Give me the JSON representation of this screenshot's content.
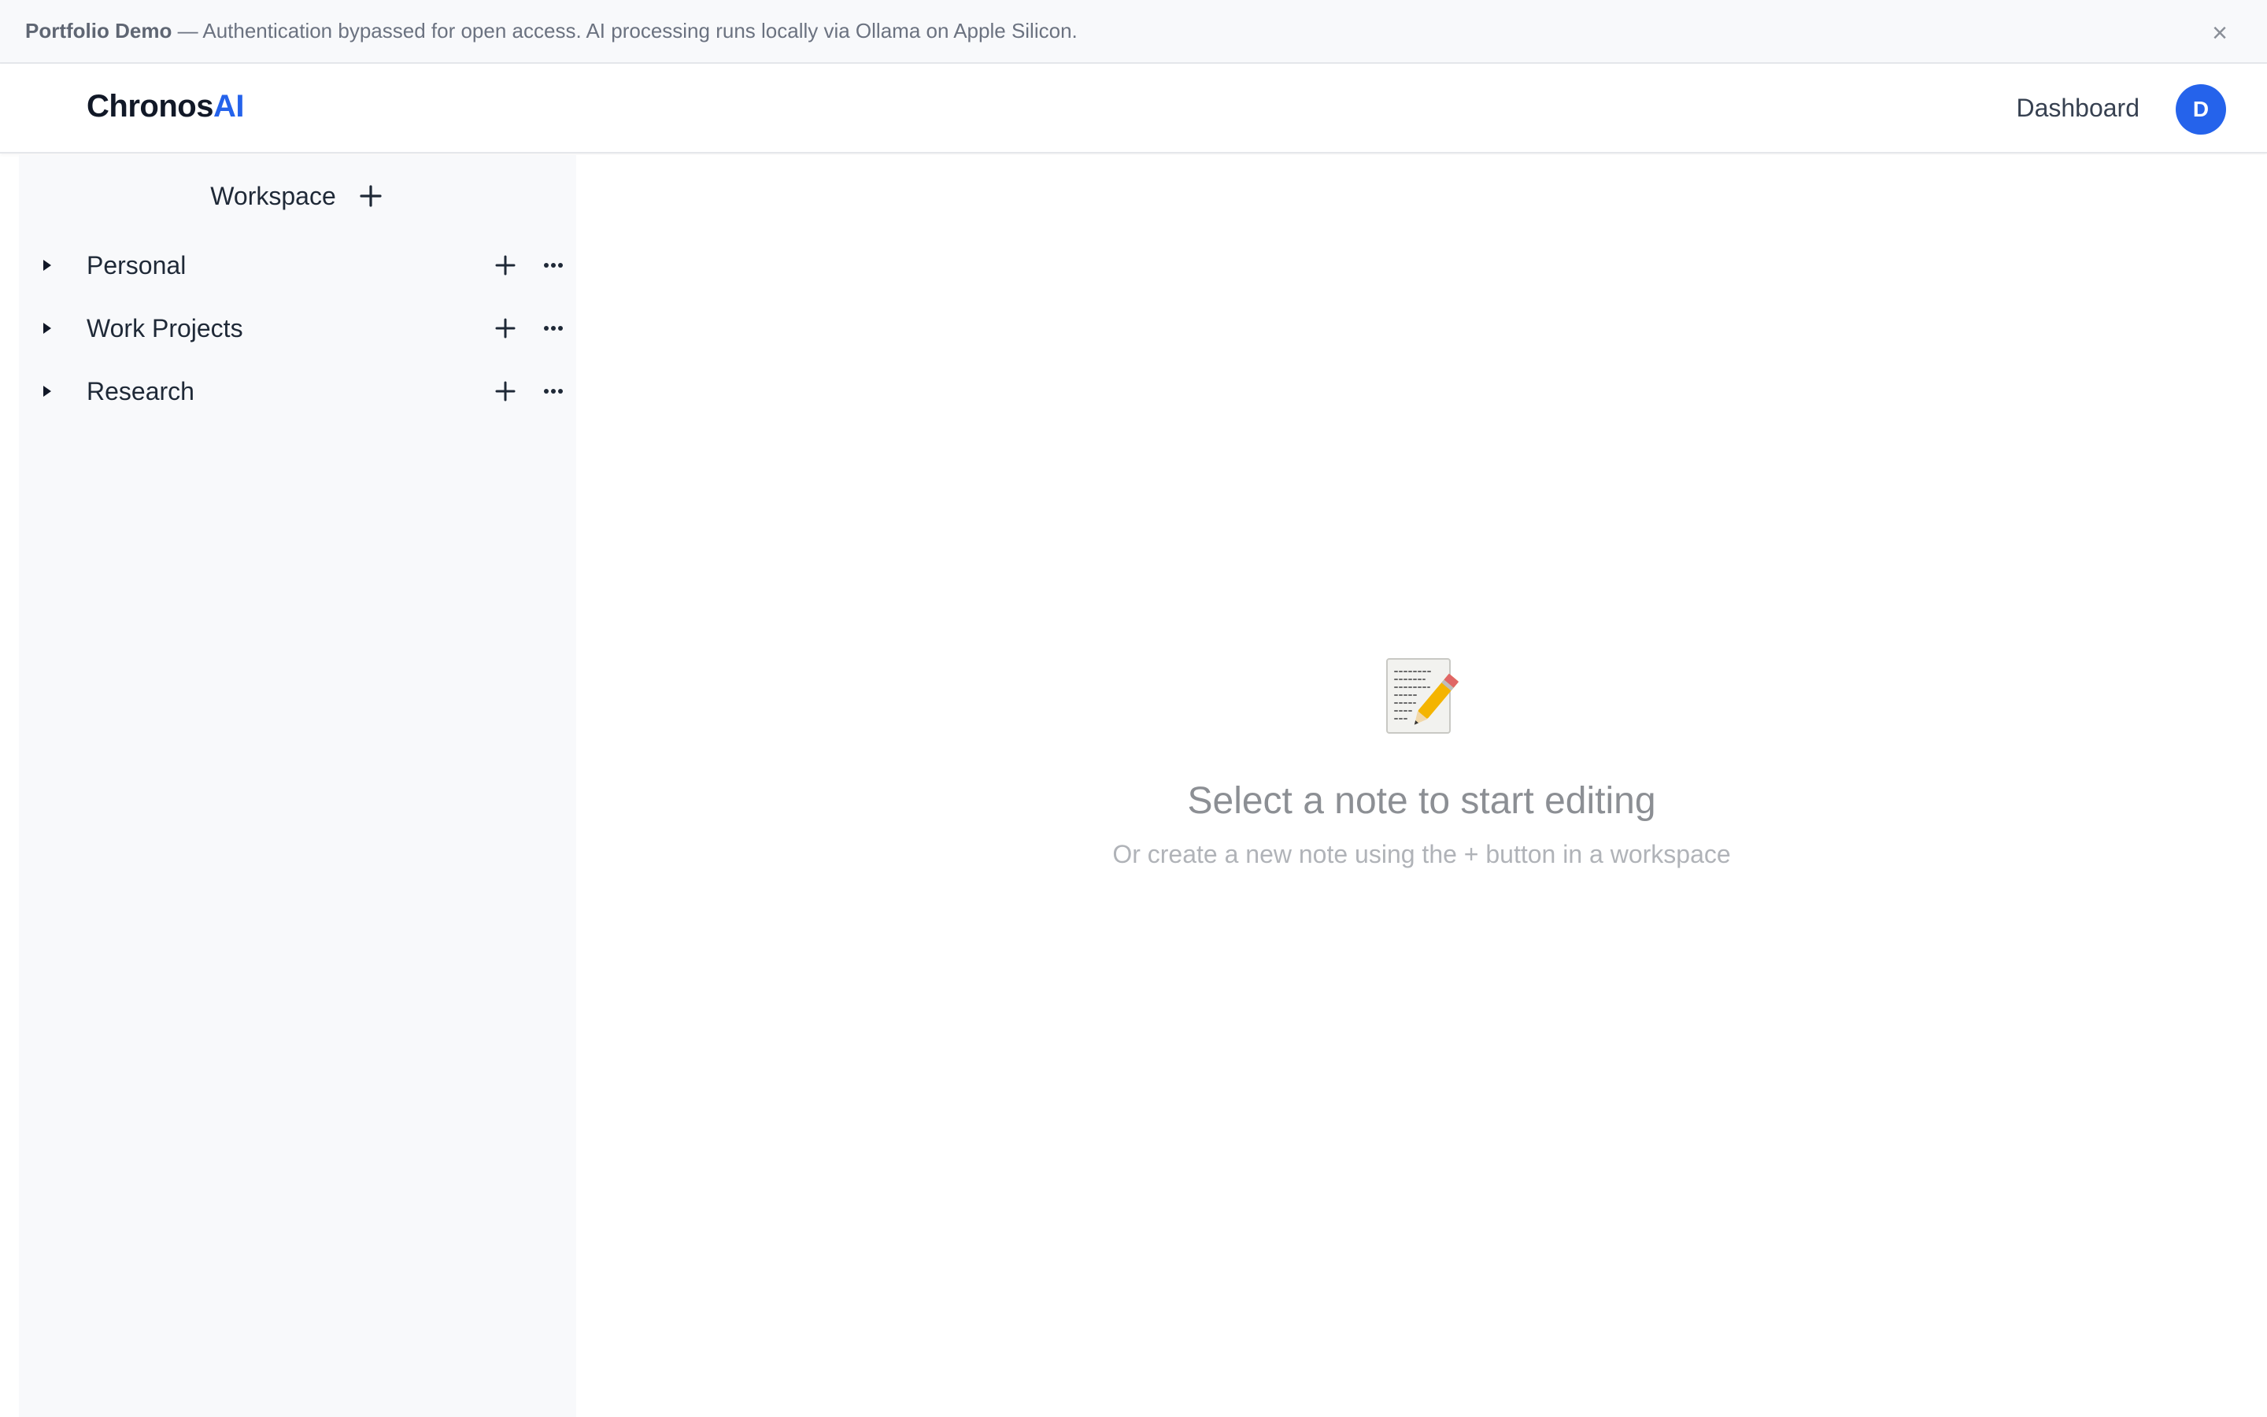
{
  "banner": {
    "strong": "Portfolio Demo",
    "message": " — Authentication bypassed for open access. AI processing runs locally via Ollama on Apple Silicon.",
    "close_glyph": "×"
  },
  "header": {
    "brand_main": "Chronos",
    "brand_accent": "AI",
    "nav_dashboard": "Dashboard",
    "avatar_initial": "D"
  },
  "sidebar": {
    "title": "Workspace",
    "workspaces": [
      {
        "label": "Personal"
      },
      {
        "label": "Work Projects"
      },
      {
        "label": "Research"
      }
    ]
  },
  "empty_state": {
    "icon": "memo-pencil-icon",
    "title": "Select a note to start editing",
    "subtitle": "Or create a new note using the + button in a workspace"
  },
  "colors": {
    "accent": "#2563eb",
    "sidebar_bg": "#f8f9fb",
    "banner_bg": "#f8f9fb"
  }
}
